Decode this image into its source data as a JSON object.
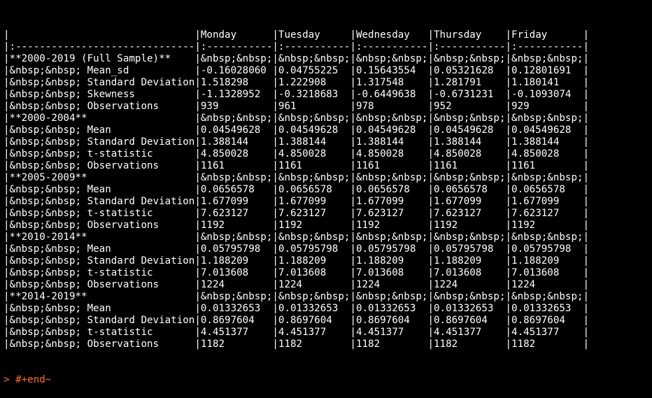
{
  "terminal": {
    "lines": [
      "|                               |Monday      |Tuesday     |Wednesday   |Thursday    |Friday      |",
      "|:------------------------------|:-----------|:-----------|:-----------|:-----------|:-----------|",
      "|**2000-2019 (Full Sample)**    |&nbsp;&nbsp;|&nbsp;&nbsp;|&nbsp;&nbsp;|&nbsp;&nbsp;|&nbsp;&nbsp;|",
      "|&nbsp;&nbsp; Mean_sd           |-0.16028060 |0.04755225  |0.15643554  |0.05321628  |0.12801691  |",
      "|&nbsp;&nbsp; Standard Deviation|1.518298    |1.222908    |1.317548    |1.281791    |1.180141    |",
      "|&nbsp;&nbsp; Skewness          |-1.1328952  |-0.3218683  |-0.6449638  |-0.6731231  |-0.1093074  |",
      "|&nbsp;&nbsp; Observations      |939         |961         |978         |952         |929         |",
      "|**2000-2004**                  |&nbsp;&nbsp;|&nbsp;&nbsp;|&nbsp;&nbsp;|&nbsp;&nbsp;|&nbsp;&nbsp;|",
      "|&nbsp;&nbsp; Mean              |0.04549628  |0.04549628  |0.04549628  |0.04549628  |0.04549628  |",
      "|&nbsp;&nbsp; Standard Deviation|1.388144    |1.388144    |1.388144    |1.388144    |1.388144    |",
      "|&nbsp;&nbsp; t-statistic       |4.850028    |4.850028    |4.850028    |4.850028    |4.850028    |",
      "|&nbsp;&nbsp; Observations      |1161        |1161        |1161        |1161        |1161        |",
      "|**2005-2009**                  |&nbsp;&nbsp;|&nbsp;&nbsp;|&nbsp;&nbsp;|&nbsp;&nbsp;|&nbsp;&nbsp;|",
      "|&nbsp;&nbsp; Mean              |0.0656578   |0.0656578   |0.0656578   |0.0656578   |0.0656578   |",
      "|&nbsp;&nbsp; Standard Deviation|1.677099    |1.677099    |1.677099    |1.677099    |1.677099    |",
      "|&nbsp;&nbsp; t-statistic       |7.623127    |7.623127    |7.623127    |7.623127    |7.623127    |",
      "|&nbsp;&nbsp; Observations      |1192        |1192        |1192        |1192        |1192        |",
      "|**2010-2014**                  |&nbsp;&nbsp;|&nbsp;&nbsp;|&nbsp;&nbsp;|&nbsp;&nbsp;|&nbsp;&nbsp;|",
      "|&nbsp;&nbsp; Mean              |0.05795798  |0.05795798  |0.05795798  |0.05795798  |0.05795798  |",
      "|&nbsp;&nbsp; Standard Deviation|1.188209    |1.188209    |1.188209    |1.188209    |1.188209    |",
      "|&nbsp;&nbsp; t-statistic       |7.013608    |7.013608    |7.013608    |7.013608    |7.013608    |",
      "|&nbsp;&nbsp; Observations      |1224        |1224        |1224        |1224        |1224        |",
      "|**2014-2019**                  |&nbsp;&nbsp;|&nbsp;&nbsp;|&nbsp;&nbsp;|&nbsp;&nbsp;|&nbsp;&nbsp;|",
      "|&nbsp;&nbsp; Mean              |0.01332653  |0.01332653  |0.01332653  |0.01332653  |0.01332653  |",
      "|&nbsp;&nbsp; Standard Deviation|0.8697604   |0.8697604   |0.8697604   |0.8697604   |0.8697604   |",
      "|&nbsp;&nbsp; t-statistic       |4.451377    |4.451377    |4.451377    |4.451377    |4.451377    |",
      "|&nbsp;&nbsp; Observations      |1182        |1182        |1182        |1182        |1182        |"
    ],
    "prompt": "> #+end~",
    "prompt_color": "#ff6a2a",
    "text_color": "#ffffff",
    "background_color": "#000000"
  }
}
